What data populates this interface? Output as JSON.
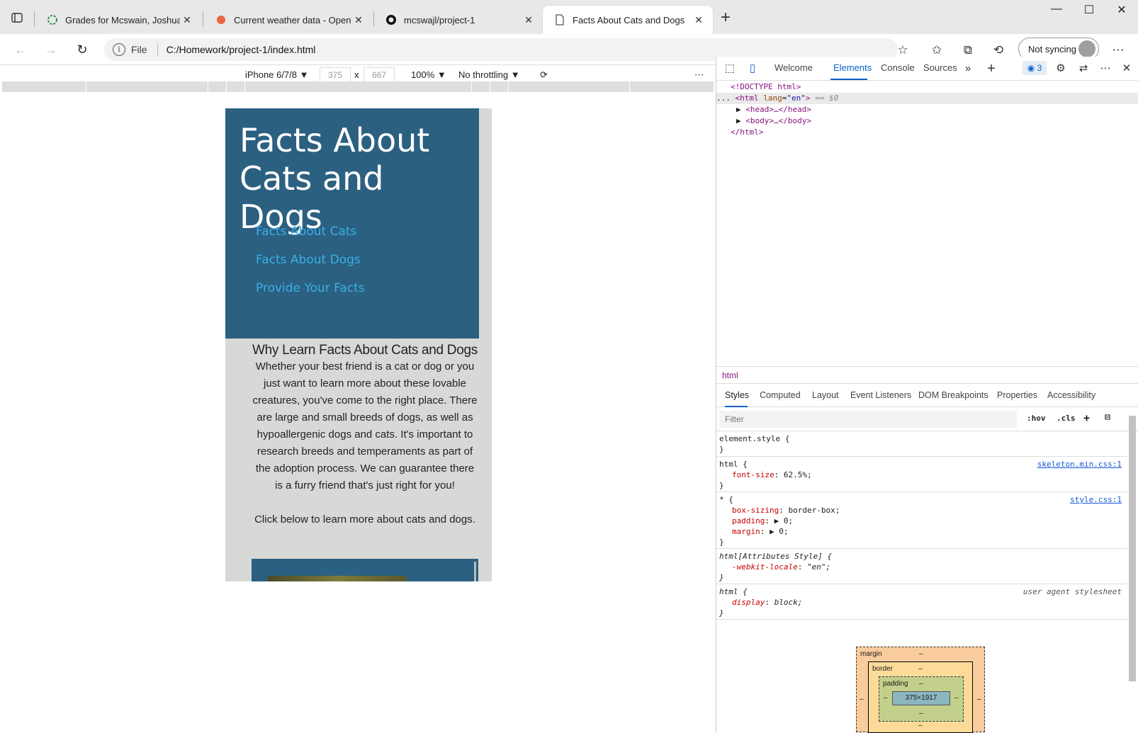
{
  "tabs": [
    {
      "title": "Grades for Mcswain, Joshua: Boo",
      "favicon": "canvas-icon",
      "color": "#2e8a4a"
    },
    {
      "title": "Current weather data - OpenWea",
      "favicon": "openweather-icon",
      "color": "#e8673c"
    },
    {
      "title": "mcswajl/project-1",
      "favicon": "github-icon",
      "color": "#111111"
    },
    {
      "title": "Facts About Cats and Dogs",
      "favicon": "file-icon",
      "color": "#555555"
    }
  ],
  "address": {
    "scheme": "File",
    "url": "C:/Homework/project-1/index.html"
  },
  "profile": {
    "label": "Not syncing"
  },
  "device_toolbar": {
    "device": "iPhone 6/7/8",
    "width": "375",
    "height": "667",
    "times": "x",
    "zoom": "100%",
    "throttling": "No throttling"
  },
  "page": {
    "title": "Facts About Cats and Dogs",
    "nav": [
      "Facts About Cats",
      "Facts About Dogs",
      "Provide Your Facts"
    ],
    "heading": "Why Learn Facts About Cats and Dogs",
    "paragraph": "Whether your best friend is a cat or dog or you just want to learn more about these lovable creatures, you've come to the right place. There are large and small breeds of dogs, as well as hypoallergenic dogs and cats. It's important to research breeds and temperaments as part of the adoption process. We can guarantee there is a furry friend that's just right for you!",
    "cta": "Click below to learn more about cats and dogs.",
    "colors": {
      "hero": "#2b6080",
      "link": "#39aee6",
      "bg": "#d7d9d6"
    }
  },
  "devtools": {
    "tabs": [
      "Welcome",
      "Elements",
      "Console",
      "Sources"
    ],
    "active_tab": "Elements",
    "issues_count": "3",
    "dom": {
      "doctype": "<!DOCTYPE html>",
      "html_open_prefix": "... ",
      "html_tag": "<html",
      "lang_attr": "lang",
      "lang_val": "\"en\"",
      "html_close_bracket": ">",
      "eq": " == $0",
      "head": "<head>…</head>",
      "body": "<body>…</body>",
      "html_close": "</html>"
    },
    "breadcrumb": "html",
    "sub_tabs": [
      "Styles",
      "Computed",
      "Layout",
      "Event Listeners",
      "DOM Breakpoints",
      "Properties",
      "Accessibility"
    ],
    "filter_placeholder": "Filter",
    "hov": ":hov",
    "cls": ".cls",
    "rules": {
      "element_style": "element.style {",
      "close": "}",
      "r1_sel": "html {",
      "r1_prop": "font-size",
      "r1_val": "62.5%;",
      "r1_src": "skeleton.min.css:1",
      "r2_sel": "* {",
      "r2_src": "style.css:1",
      "r2_p1": "box-sizing",
      "r2_v1": "border-box;",
      "r2_p2": "padding",
      "r2_v2": "▶ 0;",
      "r2_p3": "margin",
      "r2_v3": "▶ 0;",
      "r3_sel": "html[Attributes Style] {",
      "r3_prop": "-webkit-locale",
      "r3_val": "\"en\";",
      "r4_sel": "html {",
      "r4_src": "user agent stylesheet",
      "r4_prop": "display",
      "r4_val": "block;"
    },
    "box_model": {
      "margin": "margin",
      "border": "border",
      "padding": "padding",
      "content": "375×1917",
      "dash": "–"
    }
  }
}
